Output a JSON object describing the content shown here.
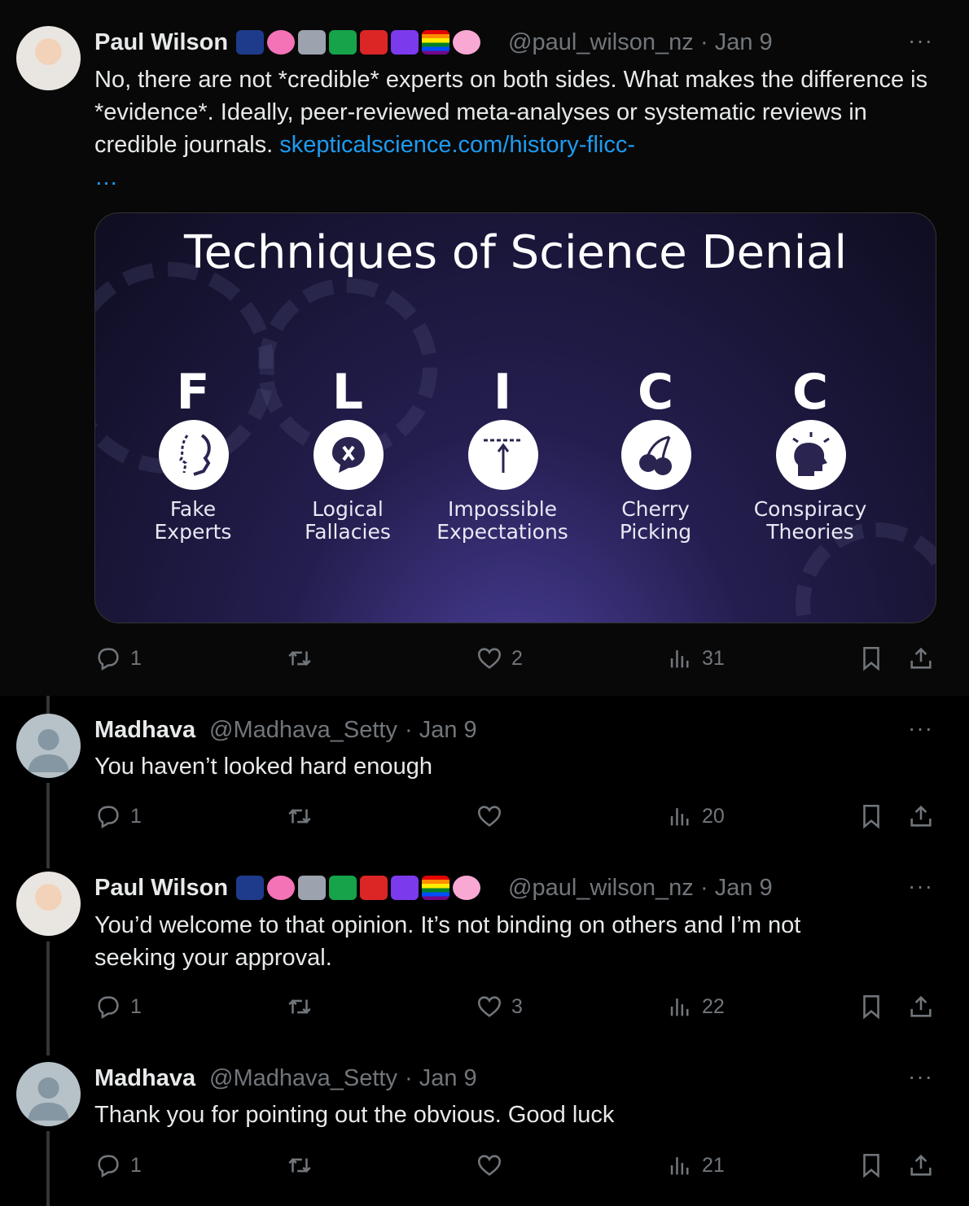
{
  "posts": [
    {
      "author": "Paul Wilson",
      "handle": "@paul_wilson_nz",
      "date": "· Jan 9",
      "text_plain": "No, there are not *credible* experts on both sides. What makes the difference is *evidence*. Ideally, peer-reviewed meta-analyses or systematic reviews in credible journals. ",
      "link": "skepticalscience.com/history-flicc-",
      "link_more": "…",
      "replies": "1",
      "reposts": "",
      "likes": "2",
      "views": "31"
    },
    {
      "author": "Madhava",
      "handle": "@Madhava_Setty",
      "date": "· Jan 9",
      "text_plain": "You haven’t looked hard enough",
      "replies": "1",
      "reposts": "",
      "likes": "",
      "views": "20"
    },
    {
      "author": "Paul Wilson",
      "handle": "@paul_wilson_nz",
      "date": "· Jan 9",
      "text_plain": "You’d welcome to that opinion. It’s not binding on others and I’m not seeking your approval.",
      "replies": "1",
      "reposts": "",
      "likes": "3",
      "views": "22"
    },
    {
      "author": "Madhava",
      "handle": "@Madhava_Setty",
      "date": "· Jan 9",
      "text_plain": "Thank you for pointing out the obvious. Good luck",
      "replies": "1",
      "reposts": "",
      "likes": "",
      "views": "21"
    }
  ],
  "more_label": "···",
  "media": {
    "title": "Techniques of Science Denial",
    "items": [
      {
        "letter": "F",
        "line1": "Fake",
        "line2": "Experts",
        "icon": "face-profile-icon"
      },
      {
        "letter": "L",
        "line1": "Logical",
        "line2": "Fallacies",
        "icon": "speech-x-icon"
      },
      {
        "letter": "I",
        "line1": "Impossible",
        "line2": "Expectations",
        "icon": "arrow-bar-icon"
      },
      {
        "letter": "C",
        "line1": "Cherry",
        "line2": "Picking",
        "icon": "cherry-icon"
      },
      {
        "letter": "C",
        "line1": "Conspiracy",
        "line2": "Theories",
        "icon": "head-sparks-icon"
      }
    ]
  },
  "emoji_colors": [
    "#1e3a8a",
    "#f472b6",
    "#9ca3af",
    "#16a34a",
    "#dc2626",
    "#7c3aed",
    "#ef4444",
    "#f9a8d4"
  ]
}
